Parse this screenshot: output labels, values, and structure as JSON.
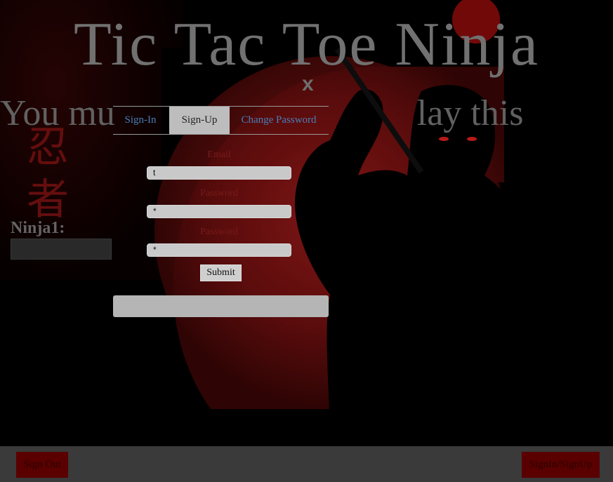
{
  "page": {
    "title": "Tic Tac Toe Ninja",
    "subtitle": "You mu",
    "subtitle_end": "lay this",
    "player_label": "Ninja1:"
  },
  "footer": {
    "signout_label": "Sign Out",
    "signin_label": "SignIn/SignUp"
  },
  "modal": {
    "close_label": "x",
    "tabs": [
      {
        "label": "Sign-In",
        "active": false
      },
      {
        "label": "Sign-Up",
        "active": true
      },
      {
        "label": "Change Password",
        "active": false
      }
    ],
    "fields": [
      {
        "label": "Email",
        "value": "t"
      },
      {
        "label": "Password",
        "value": "*"
      },
      {
        "label": "Password",
        "value": "*"
      }
    ],
    "submit_label": "Submit"
  },
  "colors": {
    "moon_red": "#7a1010",
    "footer_button": "#5a0000",
    "tab_link": "#4a7eb8",
    "footer_bar": "#3a3a3a"
  }
}
